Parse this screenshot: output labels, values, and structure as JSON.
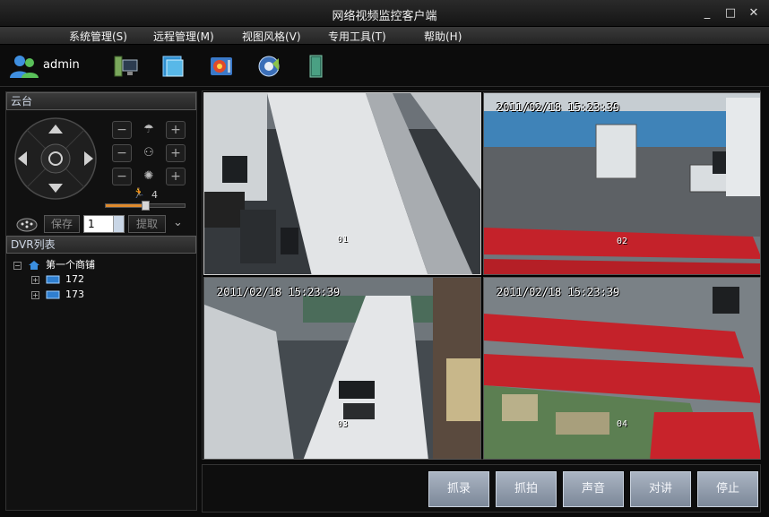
{
  "window": {
    "title": "网络视频监控客户端",
    "minimize": "_",
    "maximize": "□",
    "close": "✕"
  },
  "menu": [
    {
      "label": "系统管理(S)"
    },
    {
      "label": "远程管理(M)"
    },
    {
      "label": "视图风格(V)"
    },
    {
      "label": "专用工具(T)"
    },
    {
      "label": "帮助(H)"
    }
  ],
  "toolbar": {
    "username": "admin"
  },
  "ptz": {
    "header": "云台",
    "speed_value": "4",
    "speed_level": 0.5,
    "save_label": "保存",
    "preset_value": "1",
    "call_label": "提取"
  },
  "dvr": {
    "header": "DVR列表",
    "root": "第一个商铺",
    "devices": [
      "172",
      "173"
    ]
  },
  "cameras": [
    {
      "number": "01",
      "timestamp": ""
    },
    {
      "number": "02",
      "timestamp": "2011/02/18  15:23:39"
    },
    {
      "number": "03",
      "timestamp": "2011/02/18  15:23:39"
    },
    {
      "number": "04",
      "timestamp": "2011/02/18  15:23:39"
    }
  ],
  "actions": {
    "record": "抓录",
    "snapshot": "抓拍",
    "audio": "声音",
    "talk": "对讲",
    "stop": "停止"
  },
  "colors": {
    "accent": "#e08a2c",
    "button": "#8f9bab",
    "floor_red": "#c4222a"
  }
}
